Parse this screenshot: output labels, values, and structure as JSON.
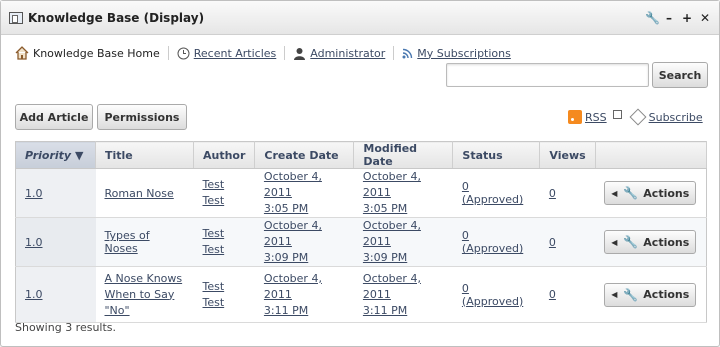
{
  "portlet": {
    "title": "Knowledge Base (Display)",
    "controls": [
      "🔧",
      "–",
      "+",
      "✕"
    ]
  },
  "nav": {
    "home": "Knowledge Base Home",
    "recent": "Recent Articles",
    "admin": "Administrator",
    "subscriptions": "My Subscriptions"
  },
  "search": {
    "placeholder": "",
    "value": "",
    "button": "Search"
  },
  "toolbar": {
    "add_article": "Add Article",
    "permissions": "Permissions",
    "rss": "RSS",
    "subscribe": "Subscribe"
  },
  "table": {
    "headers": {
      "priority": "Priority",
      "sort_indicator": "▼",
      "title": "Title",
      "author": "Author",
      "create_date": "Create Date",
      "modified_date": "Modified Date",
      "status": "Status",
      "views": "Views"
    },
    "rows": [
      {
        "priority": "1.0",
        "title": "Roman Nose",
        "author_1": "Test",
        "author_2": "Test",
        "create_1": "October 4, 2011",
        "create_2": "3:05 PM",
        "modified_1": "October 4, 2011",
        "modified_2": "3:05 PM",
        "status": "0 (Approved)",
        "views": "0",
        "action": "Actions"
      },
      {
        "priority": "1.0",
        "title": "Types of Noses",
        "author_1": "Test",
        "author_2": "Test",
        "create_1": "October 4, 2011",
        "create_2": "3:09 PM",
        "modified_1": "October 4, 2011",
        "modified_2": "3:09 PM",
        "status": "0 (Approved)",
        "views": "0",
        "action": "Actions"
      },
      {
        "priority": "1.0",
        "title_1": "A Nose Knows",
        "title_2": "When to Say",
        "title_3": "\"No\"",
        "author_1": "Test",
        "author_2": "Test",
        "create_1": "October 4, 2011",
        "create_2": "3:11 PM",
        "modified_1": "October 4, 2011",
        "modified_2": "3:11 PM",
        "status": "0 (Approved)",
        "views": "0",
        "action": "Actions"
      }
    ]
  },
  "footer": {
    "results": "Showing 3 results."
  }
}
